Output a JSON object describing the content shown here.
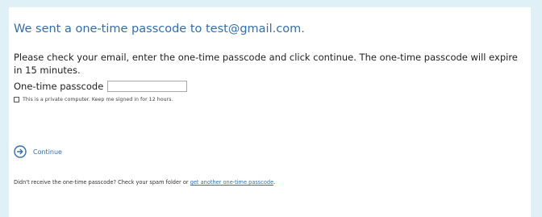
{
  "heading": "We sent a one-time passcode to test@gmail.com.",
  "instructions": "Please check your email, enter the one-time passcode and click continue. The one-time passcode will expire in 15 minutes.",
  "passcode": {
    "label": "One-time passcode",
    "value": ""
  },
  "remember": {
    "label": "This is a private computer. Keep me signed in for 12 hours.",
    "checked": false
  },
  "continue": {
    "label": "Continue",
    "icon": "arrow-right-circle-icon"
  },
  "resend": {
    "text": "Didn't receive the one-time passcode? Check your spam folder or",
    "link": "get another one-time passcode",
    "suffix": "."
  },
  "colors": {
    "background": "#dff0f6",
    "panel": "#ffffff",
    "accent": "#2f6fb3",
    "text": "#222222"
  }
}
